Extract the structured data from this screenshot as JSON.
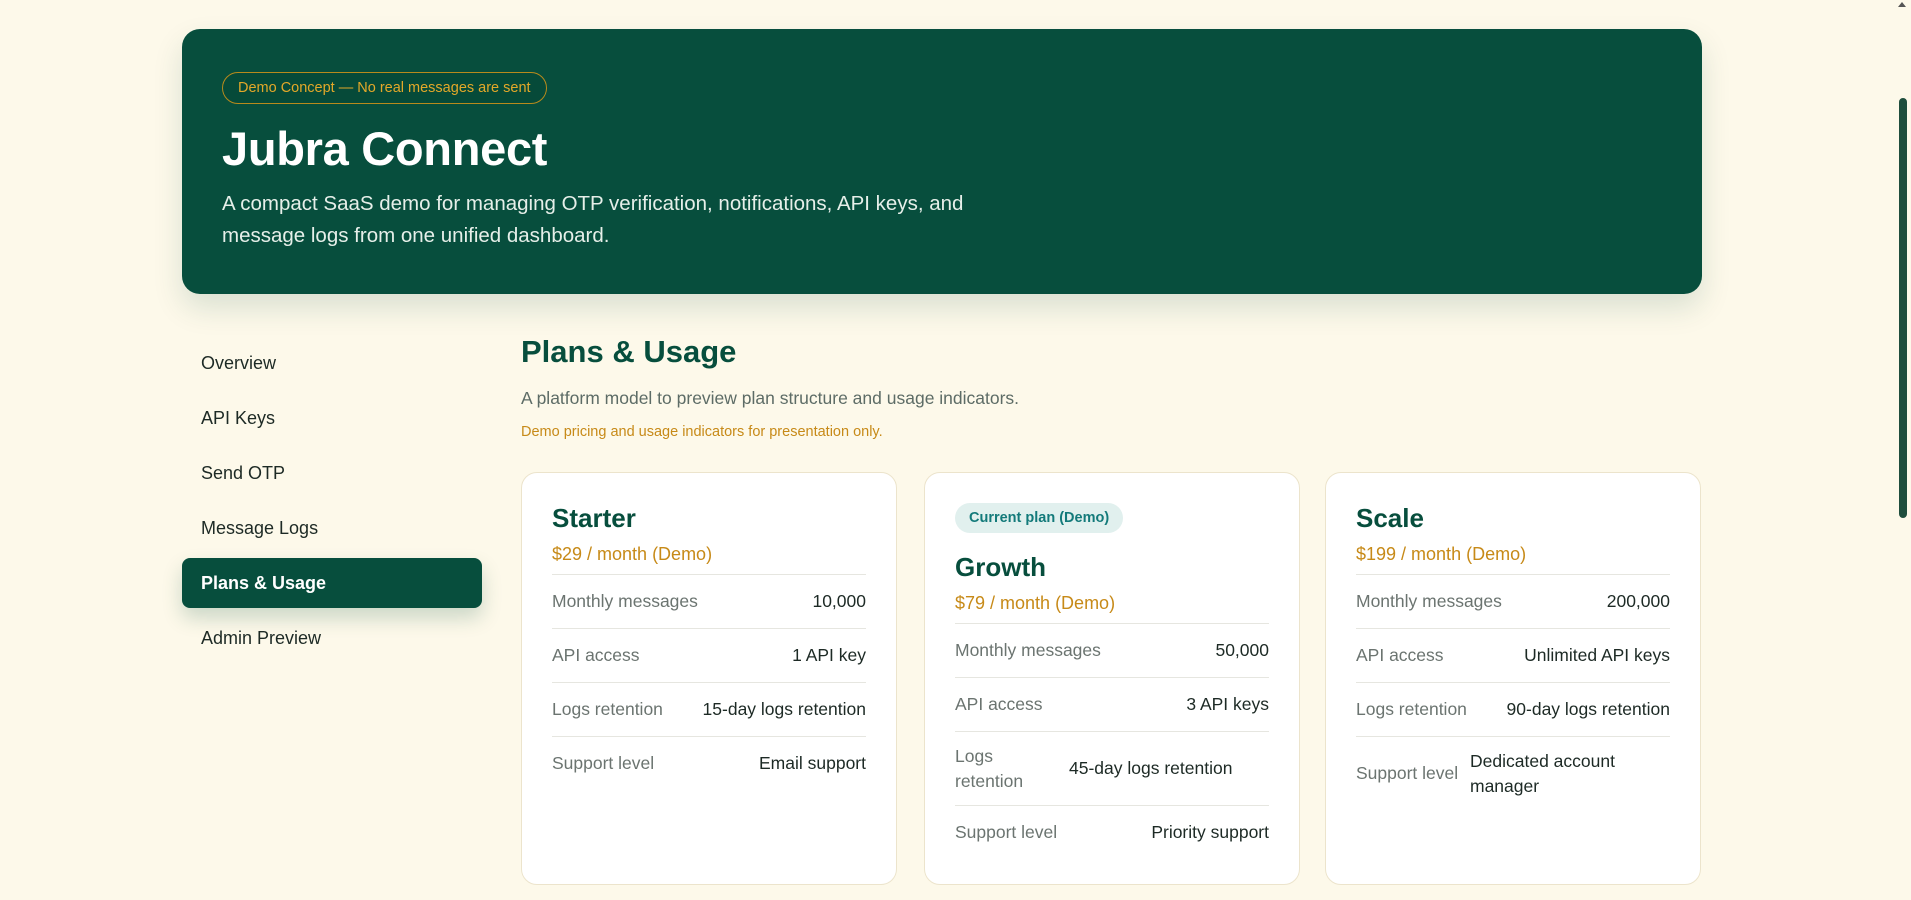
{
  "hero": {
    "badge": "Demo Concept — No real messages are sent",
    "title": "Jubra Connect",
    "subtitle": "A compact SaaS demo for managing OTP verification, notifications, API keys, and message logs from one unified dashboard."
  },
  "sidebar": {
    "items": [
      {
        "label": "Overview",
        "active": false
      },
      {
        "label": "API Keys",
        "active": false
      },
      {
        "label": "Send OTP",
        "active": false
      },
      {
        "label": "Message Logs",
        "active": false
      },
      {
        "label": "Plans & Usage",
        "active": true
      },
      {
        "label": "Admin Preview",
        "active": false
      }
    ]
  },
  "main": {
    "title": "Plans & Usage",
    "description": "A platform model to preview plan structure and usage indicators.",
    "note": "Demo pricing and usage indicators for presentation only."
  },
  "plans": [
    {
      "name": "Starter",
      "price": "$29 / month (Demo)",
      "current_badge": "",
      "rows": [
        {
          "k": "Monthly messages",
          "v": "10,000"
        },
        {
          "k": "API access",
          "v": "1 API key"
        },
        {
          "k": "Logs retention",
          "v": "15-day logs retention"
        },
        {
          "k": "Support level",
          "v": "Email support"
        }
      ]
    },
    {
      "name": "Growth",
      "price": "$79 / month (Demo)",
      "current_badge": "Current plan (Demo)",
      "rows": [
        {
          "k": "Monthly messages",
          "v": "50,000"
        },
        {
          "k": "API access",
          "v": "3 API keys"
        },
        {
          "k": "Logs retention",
          "v": "45-day logs retention"
        },
        {
          "k": "Support level",
          "v": "Priority support"
        }
      ]
    },
    {
      "name": "Scale",
      "price": "$199 / month (Demo)",
      "current_badge": "",
      "rows": [
        {
          "k": "Monthly messages",
          "v": "200,000"
        },
        {
          "k": "API access",
          "v": "Unlimited API keys"
        },
        {
          "k": "Logs retention",
          "v": "90-day logs retention"
        },
        {
          "k": "Support level",
          "v": "Dedicated account manager"
        }
      ]
    }
  ],
  "colors": {
    "brand": "#074e3d",
    "accent": "#c78a18",
    "background": "#fdf9ea"
  }
}
